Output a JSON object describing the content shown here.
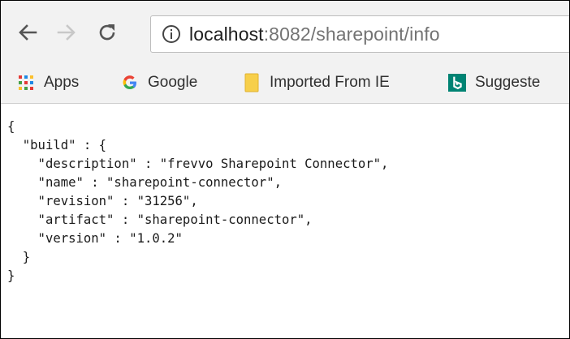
{
  "toolbar": {
    "url_host": "localhost",
    "url_rest": ":8082/sharepoint/info"
  },
  "bookmarks": [
    {
      "label": "Apps",
      "icon": "apps-grid-icon"
    },
    {
      "label": "Google",
      "icon": "google-g-icon"
    },
    {
      "label": "Imported From IE",
      "icon": "folder-icon"
    },
    {
      "label": "Suggeste",
      "icon": "bing-icon"
    }
  ],
  "colors": {
    "toolbar_bg": "#f2f2f2",
    "folder": "#f7cf4a",
    "bing": "#008373",
    "url_rest": "#737373"
  },
  "response": {
    "lines": [
      "{",
      "  \"build\" : {",
      "    \"description\" : \"frevvo Sharepoint Connector\",",
      "    \"name\" : \"sharepoint-connector\",",
      "    \"revision\" : \"31256\",",
      "    \"artifact\" : \"sharepoint-connector\",",
      "    \"version\" : \"1.0.2\"",
      "  }",
      "}"
    ]
  }
}
